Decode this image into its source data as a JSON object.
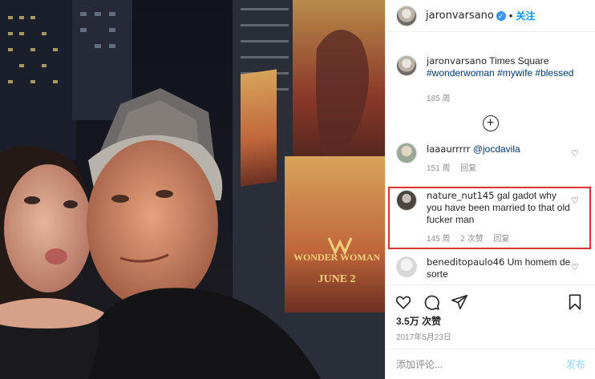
{
  "post": {
    "username": "jaronvarsano",
    "verified": true,
    "separator": "•",
    "follow_label": "关注"
  },
  "caption": {
    "username": "jaronvarsano",
    "location": "Times Square",
    "hashtags": [
      "#wonderwoman",
      "#mywife",
      "#blessed"
    ],
    "time": "185 周"
  },
  "load_more_icon": "plus-circle-icon",
  "comments": [
    {
      "username": "laaaurrrrr",
      "mention": "@jocdavila",
      "time": "151 周",
      "reply": "回复"
    },
    {
      "username": "nature_nut145",
      "text": "gal gadot why you have been married to that old fucker man",
      "time": "145 周",
      "likes": "2 次赞",
      "reply": "回复",
      "highlighted": true
    },
    {
      "username": "beneditopaulo46",
      "text": "Um homem de sorte"
    }
  ],
  "actions": {
    "likes": "3.5万 次赞",
    "date": "2017年5月23日",
    "comment_placeholder": "添加评论...",
    "post_label": "发布"
  },
  "photo": {
    "billboard_title": "WONDER WOMAN",
    "billboard_date": "JUNE 2"
  },
  "colors": {
    "accent": "#0095f6",
    "hashtag": "#00376b",
    "muted": "#8e8e8e",
    "highlight_border": "#e03030"
  }
}
